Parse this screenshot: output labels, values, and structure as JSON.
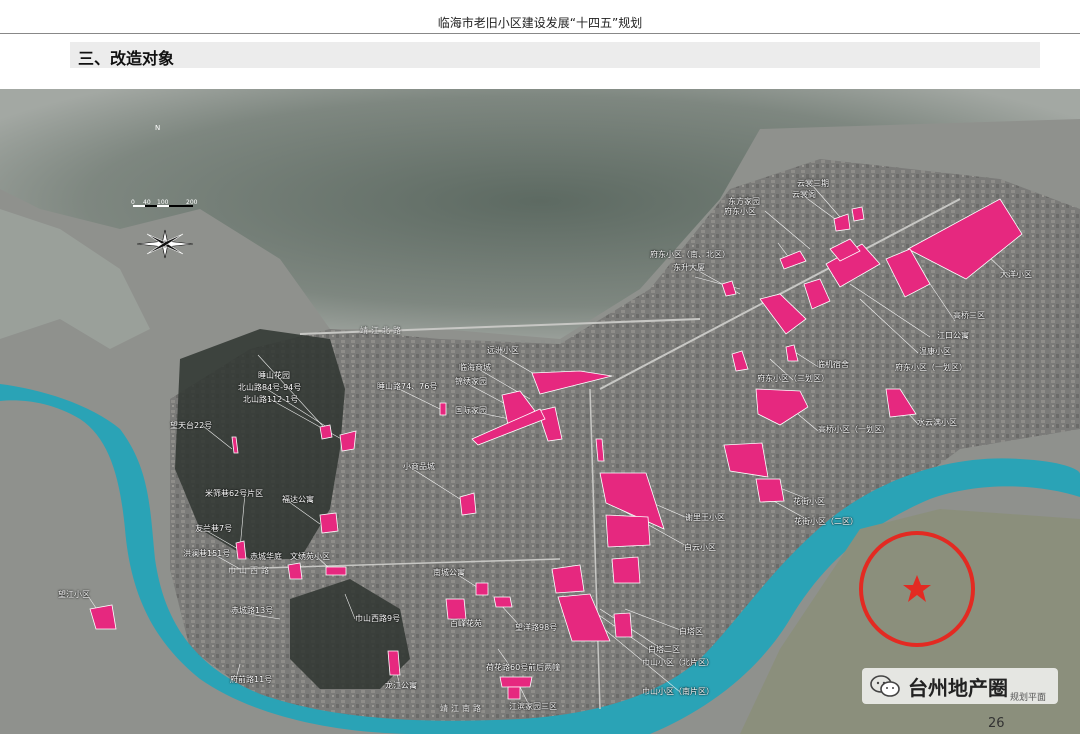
{
  "header": {
    "doc_title": "临海市老旧小区建设发展“十四五”规划",
    "section_title": "三、改造对象"
  },
  "map": {
    "compass": {
      "north": "N"
    },
    "scale": {
      "t0": "0",
      "t1": "40",
      "t2": "100",
      "t3": "200"
    },
    "roads": {
      "r1": "靖江北路",
      "r2": "巾山西路",
      "r3": "靖江南路"
    },
    "labels": {
      "yuanzhou": "远洲小区",
      "linhai_shangcheng": "临海商城",
      "jinxiu": "锦绣家园",
      "guoji": "国际家园",
      "dongfang": "东方家园",
      "fudong_a": "府东小区",
      "yunshang3": "云裳三期",
      "yunshang": "云裳阁",
      "fudong_nb": "府东小区（南、北区）",
      "dongsheng": "东升大厦",
      "dayang": "大洋小区",
      "gaoqiao3": "高桥三区",
      "jiangkou": "江口公寓",
      "fudong_yi": "府东小区（一划区）",
      "xinqiao": "温康小区",
      "linji": "临机宿舍",
      "fufu3": "府东小区（三划区）",
      "gaoqiao1": "高桥小区（一划区）",
      "shuiyun": "水云满小区",
      "zhengshan": "睡山花园",
      "beishan84": "北山路84号-94号",
      "beishan112": "北山路112-1号",
      "wangtiantai": "望天台22号",
      "zhengshan74": "睡山路74、76号",
      "xiaoshangpin": "小商品城",
      "miyuan": "米筛巷62号片区",
      "fuda": "福达公寓",
      "youlan": "友兰巷7号",
      "hongqiao": "洪澜巷151号",
      "chicheng": "赤城华庭",
      "wenxiu": "文绣苑小区",
      "wangjiang": "望江小区",
      "chicheng13": "赤城路13号",
      "jinshan9": "巾山西路9号",
      "fuqian11": "府前路11号",
      "nancheng": "南城公寓",
      "baixi": "百峰花苑",
      "wangyang": "望洋路98号",
      "huaxiang": "荷花路60号前后两幢",
      "longjiang": "龙江公寓",
      "jiangbin": "江滨家园三区",
      "xiele": "谢里王小区",
      "baiyun": "白云小区",
      "huajie": "花街小区",
      "huajie2": "花街小区（二区）",
      "baita": "白塔区",
      "baita2": "白塔二区",
      "jinshan_north": "巾山小区（北片区）",
      "jinshan_south": "巾山小区（南片区）"
    }
  },
  "watermark": {
    "text": "台州地产圈",
    "sub_text": "规划平面"
  },
  "page_number": "26",
  "colors": {
    "parcel": "#e6287f",
    "river": "#2aa3b6",
    "urban": "#7d7d7d",
    "mountain": "#4f5a52"
  }
}
